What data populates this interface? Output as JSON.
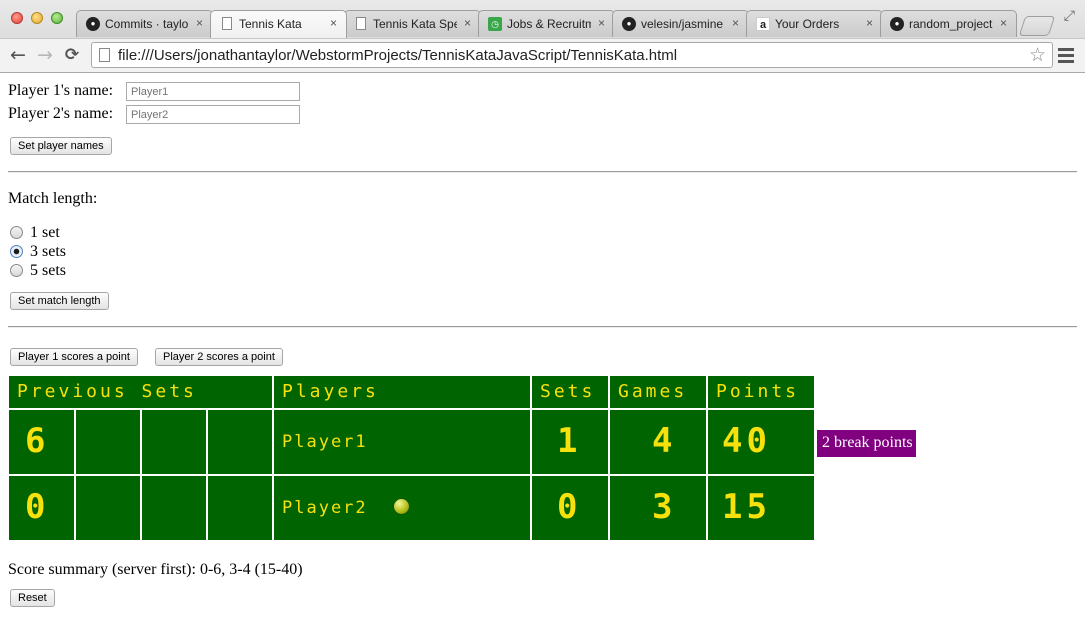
{
  "browser": {
    "tabs": [
      {
        "title": "Commits · taylo",
        "icon": "github-icon",
        "active": false
      },
      {
        "title": "Tennis Kata",
        "icon": "document-icon",
        "active": true
      },
      {
        "title": "Tennis Kata Spe",
        "icon": "document-icon",
        "active": false
      },
      {
        "title": "Jobs & Recruitm",
        "icon": "jobs-icon",
        "active": false
      },
      {
        "title": "velesin/jasmine",
        "icon": "github-icon",
        "active": false
      },
      {
        "title": "Your Orders",
        "icon": "amazon-icon",
        "active": false
      },
      {
        "title": "random_project",
        "icon": "github-icon",
        "active": false
      }
    ],
    "close_glyph": "×",
    "back_glyph": "←",
    "forward_glyph": "→",
    "reload_glyph": "C",
    "url": "file:///Users/jonathantaylor/WebstormProjects/TennisKataJavaScript/TennisKata.html",
    "star_glyph": "☆",
    "resize_glyph": "⤢"
  },
  "names": {
    "player1_label": "Player 1's name:",
    "player1_placeholder": "Player1",
    "player2_label": "Player 2's name:",
    "player2_placeholder": "Player2",
    "set_button": "Set player names"
  },
  "match_length": {
    "label": "Match length:",
    "options": [
      {
        "label": "1 set",
        "checked": false
      },
      {
        "label": "3 sets",
        "checked": true
      },
      {
        "label": "5 sets",
        "checked": false
      }
    ],
    "set_button": "Set match length"
  },
  "controls": {
    "p1_point": "Player 1 scores a point",
    "p2_point": "Player 2 scores a point"
  },
  "scoreboard": {
    "headers": {
      "previous_sets": "Previous Sets",
      "players": "Players",
      "sets": "Sets",
      "games": "Games",
      "points": "Points"
    },
    "colors": {
      "background": "#006400",
      "text": "#f7e10c",
      "badge": "#800080"
    },
    "rows": [
      {
        "prev": [
          "6",
          "",
          "",
          ""
        ],
        "player": "Player1",
        "serving": false,
        "sets": "1",
        "games": "4",
        "points": "40"
      },
      {
        "prev": [
          "0",
          "",
          "",
          ""
        ],
        "player": "Player2",
        "serving": true,
        "sets": "0",
        "games": "3",
        "points": "15"
      }
    ],
    "badge": "2 break points"
  },
  "summary": "Score summary (server first): 0-6, 3-4 (15-40)",
  "reset_button": "Reset"
}
